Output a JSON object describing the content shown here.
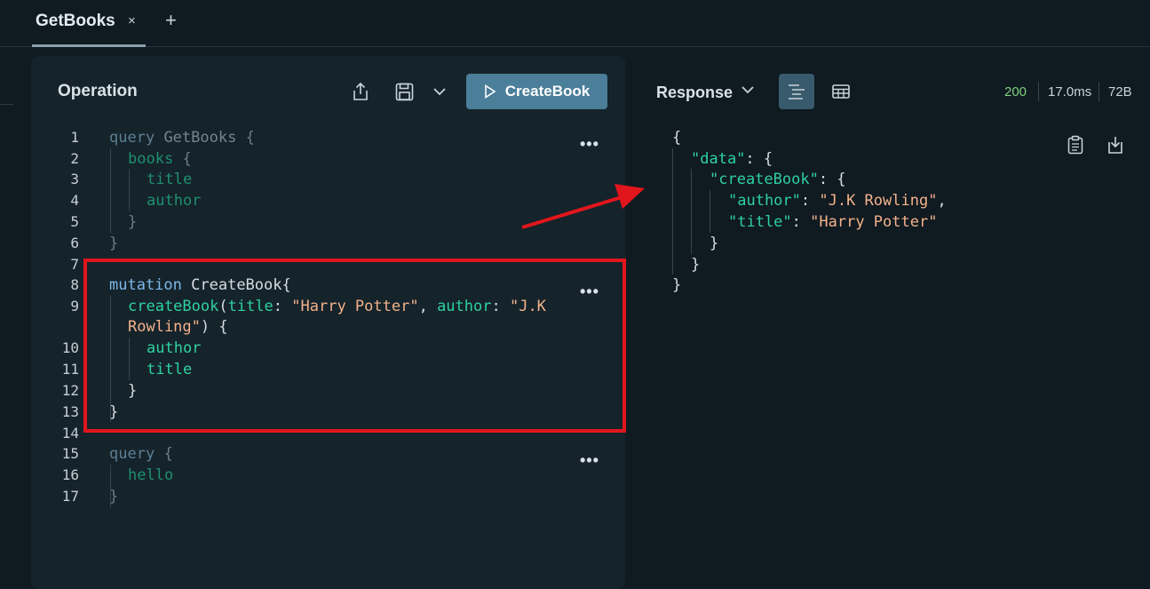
{
  "tabs": [
    {
      "label": "GetBooks",
      "close": "×"
    }
  ],
  "tab_add": "+",
  "operation": {
    "title": "Operation",
    "run_button": "CreateBook",
    "line_numbers": [
      "1",
      "2",
      "3",
      "4",
      "5",
      "6",
      "7",
      "8",
      "9",
      "10",
      "11",
      "12",
      "13",
      "14",
      "15",
      "16",
      "17"
    ],
    "code": {
      "q1_keyword": "query",
      "q1_name": "GetBooks",
      "q1_field": "books",
      "q1_sub1": "title",
      "q1_sub2": "author",
      "m_keyword": "mutation",
      "m_name": "CreateBook",
      "m_field": "createBook",
      "m_arg1": "title",
      "m_val1": "\"Harry Potter\"",
      "m_arg2": "author",
      "m_val2a": "\"J.K",
      "m_val2b": "Rowling\"",
      "m_sub1": "author",
      "m_sub2": "title",
      "q2_keyword": "query",
      "q2_field": "hello"
    },
    "more_menu": "•••"
  },
  "response": {
    "label": "Response",
    "status": "200",
    "time": "17.0ms",
    "size": "72B",
    "json": {
      "data_key": "\"data\"",
      "create_key": "\"createBook\"",
      "author_key": "\"author\"",
      "author_val": "\"J.K Rowling\"",
      "title_key": "\"title\"",
      "title_val": "\"Harry Potter\""
    }
  },
  "colors": {
    "status_ok": "#7fd07f",
    "highlight_box": "#e0161c",
    "arrow": "#e0161c",
    "run_button": "#4b7e99"
  }
}
